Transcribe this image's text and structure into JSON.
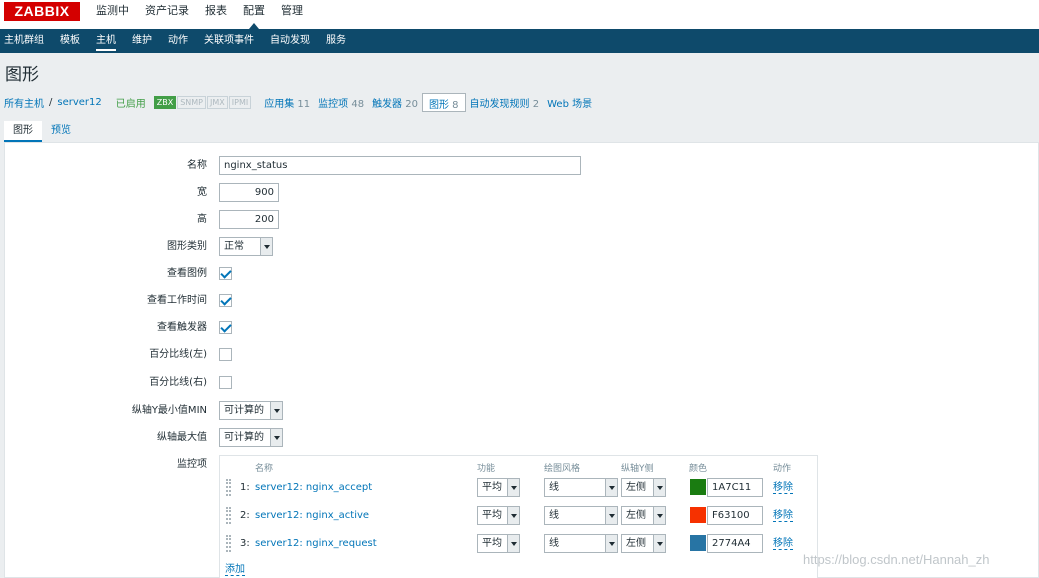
{
  "logo": "ZABBIX",
  "main_menu": [
    {
      "label": "监测中",
      "active": false
    },
    {
      "label": "资产记录",
      "active": false
    },
    {
      "label": "报表",
      "active": false
    },
    {
      "label": "配置",
      "active": true
    },
    {
      "label": "管理",
      "active": false
    }
  ],
  "sub_menu": [
    {
      "label": "主机群组"
    },
    {
      "label": "模板"
    },
    {
      "label": "主机",
      "active": true
    },
    {
      "label": "维护"
    },
    {
      "label": "动作"
    },
    {
      "label": "关联项事件"
    },
    {
      "label": "自动发现"
    },
    {
      "label": "服务"
    }
  ],
  "page_title": "图形",
  "host_nav": {
    "all_hosts": "所有主机",
    "separator": "/",
    "host": "server12",
    "status": "已启用",
    "tags": [
      "ZBX",
      "SNMP",
      "JMX",
      "IPMI"
    ],
    "links": [
      {
        "label": "应用集",
        "count": "11"
      },
      {
        "label": "监控项",
        "count": "48"
      },
      {
        "label": "触发器",
        "count": "20"
      },
      {
        "label": "图形",
        "count": "8"
      },
      {
        "label": "自动发现规则",
        "count": "2"
      },
      {
        "label": "Web 场景",
        "count": ""
      }
    ]
  },
  "tabs": [
    "图形",
    "预览"
  ],
  "form": {
    "name_label": "名称",
    "name_value": "nginx_status",
    "width_label": "宽",
    "width_value": "900",
    "height_label": "高",
    "height_value": "200",
    "type_label": "图形类别",
    "type_value": "正常",
    "legend_label": "查看图例",
    "legend_checked": true,
    "worktime_label": "查看工作时间",
    "worktime_checked": true,
    "triggers_label": "查看触发器",
    "triggers_checked": true,
    "pct_left_label": "百分比线(左)",
    "pct_left_checked": false,
    "pct_right_label": "百分比线(右)",
    "pct_right_checked": false,
    "ymin_label": "纵轴Y最小值MIN",
    "ymin_value": "可计算的",
    "ymax_label": "纵轴最大值",
    "ymax_value": "可计算的",
    "items_label": "监控项"
  },
  "items": {
    "headers": [
      "名称",
      "功能",
      "绘图风格",
      "纵轴Y侧",
      "颜色",
      "动作"
    ],
    "rows": [
      {
        "num": "1:",
        "name": "server12: nginx_accept",
        "func": "平均",
        "style": "线",
        "side": "左侧",
        "color": "1A7C11",
        "hex": "#1A7C11",
        "action": "移除"
      },
      {
        "num": "2:",
        "name": "server12: nginx_active",
        "func": "平均",
        "style": "线",
        "side": "左侧",
        "color": "F63100",
        "hex": "#F63100",
        "action": "移除"
      },
      {
        "num": "3:",
        "name": "server12: nginx_request",
        "func": "平均",
        "style": "线",
        "side": "左侧",
        "color": "2774A4",
        "hex": "#2774A4",
        "action": "移除"
      }
    ],
    "add": "添加"
  },
  "watermark": "https://blog.csdn.net/Hannah_zh"
}
